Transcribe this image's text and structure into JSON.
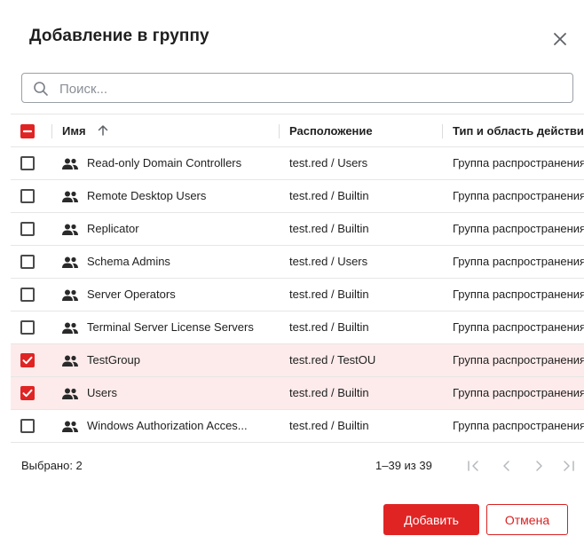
{
  "dialog": {
    "title": "Добавление в группу",
    "close_icon": "close-icon"
  },
  "search": {
    "placeholder": "Поиск...",
    "value": "",
    "icon": "search-icon"
  },
  "table": {
    "columns": {
      "name": "Имя",
      "location": "Расположение",
      "type": "Тип и область действия"
    },
    "sort": {
      "column": "name",
      "direction": "ascending",
      "icon": "arrow-up-icon"
    },
    "select_all_state": "indeterminate",
    "rows": [
      {
        "name": "Read-only Domain Controllers",
        "location": "test.red / Users",
        "type": "Группа распространения",
        "checked": false
      },
      {
        "name": "Remote Desktop Users",
        "location": "test.red / Builtin",
        "type": "Группа распространения",
        "checked": false
      },
      {
        "name": "Replicator",
        "location": "test.red / Builtin",
        "type": "Группа распространения",
        "checked": false
      },
      {
        "name": "Schema Admins",
        "location": "test.red / Users",
        "type": "Группа распространения",
        "checked": false
      },
      {
        "name": "Server Operators",
        "location": "test.red / Builtin",
        "type": "Группа распространения",
        "checked": false
      },
      {
        "name": "Terminal Server License Servers",
        "location": "test.red / Builtin",
        "type": "Группа распространения",
        "checked": false
      },
      {
        "name": "TestGroup",
        "location": "test.red / TestOU",
        "type": "Группа распространения",
        "checked": true
      },
      {
        "name": "Users",
        "location": "test.red / Builtin",
        "type": "Группа распространения",
        "checked": true
      },
      {
        "name": "Windows Authorization Acces...",
        "location": "test.red / Builtin",
        "type": "Группа распространения",
        "checked": false
      }
    ]
  },
  "footer": {
    "selected_label": "Выбрано: 2",
    "range_label": "1–39 из 39"
  },
  "actions": {
    "add_label": "Добавить",
    "cancel_label": "Отмена"
  },
  "colors": {
    "accent": "#e02424",
    "selected_row": "#fdebeb"
  }
}
